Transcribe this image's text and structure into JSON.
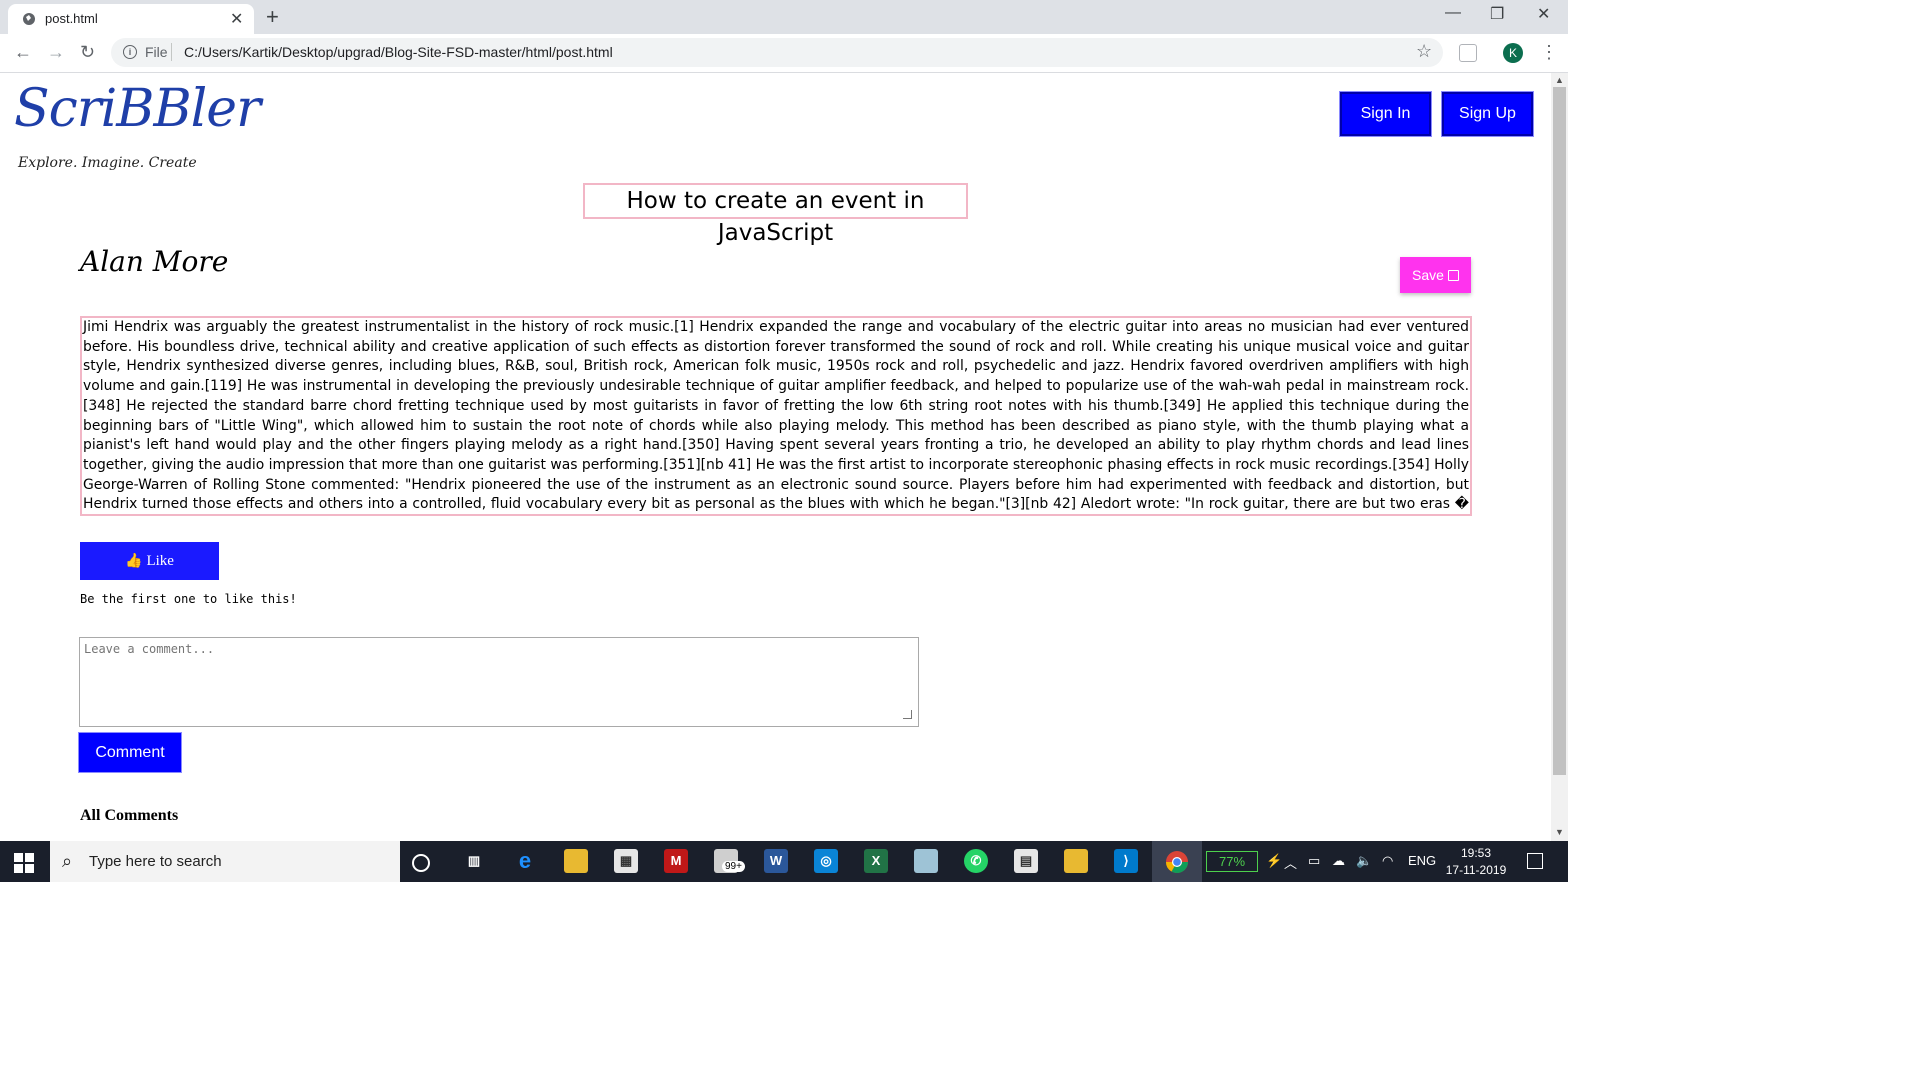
{
  "browser": {
    "tab_title": "post.html",
    "tab_close": "✕",
    "new_tab": "+",
    "scheme": "File",
    "url": "C:/Users/Kartik/Desktop/upgrad/Blog-Site-FSD-master/html/post.html",
    "profile_initial": "K",
    "controls": {
      "minimize": "—",
      "restore": "❐",
      "close": "✕"
    }
  },
  "site": {
    "logo": "ScriBBler",
    "tagline": "Explore. Imagine. Create",
    "sign_in": "Sign In",
    "sign_up": "Sign Up"
  },
  "post": {
    "title": "How to create an event in JavaScript",
    "author": "Alan More",
    "save_label": "Save",
    "content": "Jimi Hendrix was arguably the greatest instrumentalist in the history of rock music.[1] Hendrix expanded the range and vocabulary of the electric guitar into areas no musician had ever ventured before. His boundless drive, technical ability and creative application of such effects as distortion forever transformed the sound of rock and roll. While creating his unique musical voice and guitar style, Hendrix synthesized diverse genres, including blues, R&B, soul, British rock, American folk music, 1950s rock and roll, psychedelic and jazz. Hendrix favored overdriven amplifiers with high volume and gain.[119] He was instrumental in developing the previously undesirable technique of guitar amplifier feedback, and helped to popularize use of the wah-wah pedal in mainstream rock.[348] He rejected the standard barre chord fretting technique used by most guitarists in favor of fretting the low 6th string root notes with his thumb.[349] He applied this technique during the beginning bars of \"Little Wing\", which allowed him to sustain the root note of chords while also playing melody. This method has been described as piano style, with the thumb playing what a pianist's left hand would play and the other fingers playing melody as a right hand.[350] Having spent several years fronting a trio, he developed an ability to play rhythm chords and lead lines together, giving the audio impression that more than one guitarist was performing.[351][nb 41] He was the first artist to incorporate stereophonic phasing effects in rock music recordings.[354] Holly George-Warren of Rolling Stone commented: \"Hendrix pioneered the use of the instrument as an electronic sound source. Players before him had experimented with feedback and distortion, but Hendrix turned those effects and others into a controlled, fluid vocabulary every bit as personal as the blues with which he began.\"[3][nb 42] Aledort wrote: \"In rock guitar, there are but two eras � before Hendrix and after Hendrix.\"",
    "like_label": "Like",
    "like_note": "Be the first one to like this!",
    "comment_placeholder": "Leave a comment...",
    "comment_button": "Comment",
    "all_comments": "All Comments"
  },
  "taskbar": {
    "search_placeholder": "Type here to search",
    "badge": "99+",
    "battery": "77%",
    "language": "ENG",
    "time": "19:53",
    "date": "17-11-2019"
  },
  "colors": {
    "primary_button": "#0000ff",
    "save_button": "#ff33ee",
    "title_border": "#f2b6c6",
    "logo": "#1f3fa8"
  }
}
